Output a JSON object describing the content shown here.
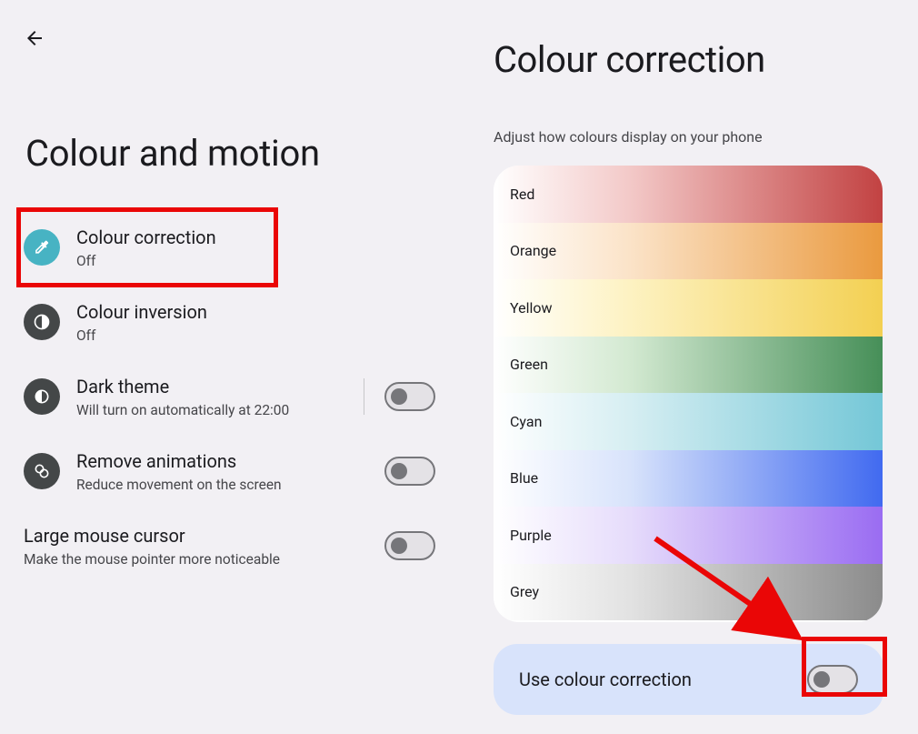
{
  "left": {
    "title": "Colour and motion",
    "items": {
      "colour_correction": {
        "title": "Colour correction",
        "sub": "Off"
      },
      "colour_inversion": {
        "title": "Colour inversion",
        "sub": "Off"
      },
      "dark_theme": {
        "title": "Dark theme",
        "sub": "Will turn on automatically at 22:00"
      },
      "remove_animations": {
        "title": "Remove animations",
        "sub": "Reduce movement on the screen"
      },
      "large_cursor": {
        "title": "Large mouse cursor",
        "sub": "Make the mouse pointer more noticeable"
      }
    }
  },
  "right": {
    "title": "Colour correction",
    "subtitle": "Adjust how colours display on your phone",
    "use_label": "Use colour correction",
    "palette": {
      "red": "Red",
      "orange": "Orange",
      "yellow": "Yellow",
      "green": "Green",
      "cyan": "Cyan",
      "blue": "Blue",
      "purple": "Purple",
      "grey": "Grey"
    }
  }
}
